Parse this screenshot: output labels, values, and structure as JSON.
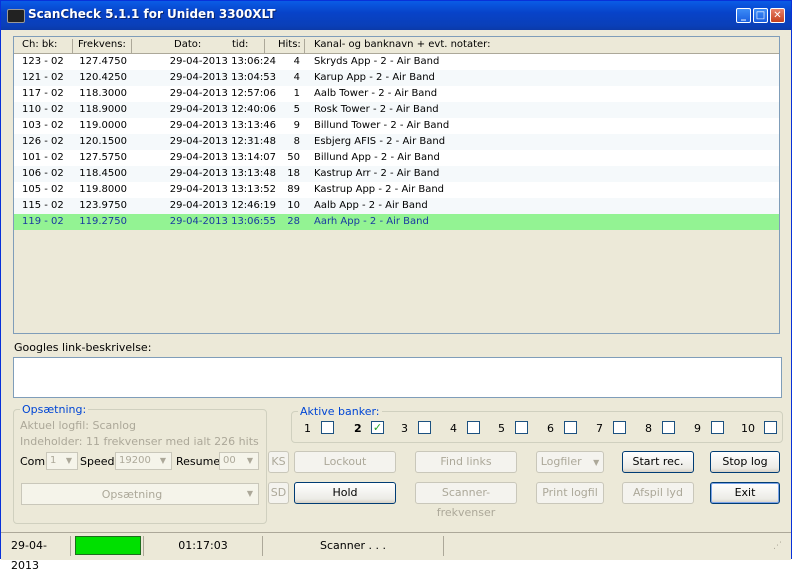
{
  "window": {
    "title": "ScanCheck 5.1.1 for Uniden 3300XLT",
    "controls": {
      "minimize": "_",
      "maximize": "□",
      "close": "✕"
    }
  },
  "list": {
    "headers": {
      "ch": "Ch:  bk:",
      "freq": "Frekvens:",
      "date": "Dato:",
      "time": "tid:",
      "hits": "Hits:",
      "name": "Kanal- og banknavn + evt. notater:"
    },
    "rows": [
      {
        "ch": "123 - 02",
        "freq": "127.4750",
        "dt": "29-04-2013 13:06:24",
        "hits": "4",
        "name": "Skryds App  -  2 - Air Band"
      },
      {
        "ch": "121 - 02",
        "freq": "120.4250",
        "dt": "29-04-2013 13:04:53",
        "hits": "4",
        "name": "Karup App  -  2 - Air Band"
      },
      {
        "ch": "117 - 02",
        "freq": "118.3000",
        "dt": "29-04-2013 12:57:06",
        "hits": "1",
        "name": "Aalb Tower  -  2 - Air Band"
      },
      {
        "ch": "110 - 02",
        "freq": "118.9000",
        "dt": "29-04-2013 12:40:06",
        "hits": "5",
        "name": "Rosk Tower  -  2 - Air Band"
      },
      {
        "ch": "103 - 02",
        "freq": "119.0000",
        "dt": "29-04-2013 13:13:46",
        "hits": "9",
        "name": "Billund Tower  -  2 - Air Band"
      },
      {
        "ch": "126 - 02",
        "freq": "120.1500",
        "dt": "29-04-2013 12:31:48",
        "hits": "8",
        "name": "Esbjerg AFIS  -  2 - Air Band"
      },
      {
        "ch": "101 - 02",
        "freq": "127.5750",
        "dt": "29-04-2013 13:14:07",
        "hits": "50",
        "name": "Billund App  -  2 - Air Band"
      },
      {
        "ch": "106 - 02",
        "freq": "118.4500",
        "dt": "29-04-2013 13:13:48",
        "hits": "18",
        "name": "Kastrup Arr  -  2 - Air Band"
      },
      {
        "ch": "105 - 02",
        "freq": "119.8000",
        "dt": "29-04-2013 13:13:52",
        "hits": "89",
        "name": "Kastrup App  -  2 - Air Band"
      },
      {
        "ch": "115 - 02",
        "freq": "123.9750",
        "dt": "29-04-2013 12:46:19",
        "hits": "10",
        "name": "Aalb App  -  2 - Air Band"
      },
      {
        "ch": "119 - 02",
        "freq": "119.2750",
        "dt": "29-04-2013 13:06:55",
        "hits": "28",
        "name": "Aarh App  -  2 - Air Band"
      }
    ],
    "selected_row_color": "#93f393"
  },
  "google": {
    "label": "Googles link-beskrivelse:",
    "text": ""
  },
  "setup": {
    "legend": "Opsætning:",
    "logfile_line": "Aktuel logfil: Scanlog",
    "contents_line": "Indeholder:  11 frekvenser med ialt 226 hits",
    "com_label": "Com:",
    "com_value": "1",
    "speed_label": "Speed:",
    "speed_value": "19200",
    "resume_label": "Resume",
    "resume_value": "00",
    "setup_combo": "Opsætning"
  },
  "banks": {
    "legend": "Aktive banker:",
    "items": [
      {
        "num": "1",
        "checked": false
      },
      {
        "num": "2",
        "checked": true
      },
      {
        "num": "3",
        "checked": false
      },
      {
        "num": "4",
        "checked": false
      },
      {
        "num": "5",
        "checked": false
      },
      {
        "num": "6",
        "checked": false
      },
      {
        "num": "7",
        "checked": false
      },
      {
        "num": "8",
        "checked": false
      },
      {
        "num": "9",
        "checked": false
      },
      {
        "num": "10",
        "checked": false
      }
    ]
  },
  "buttons": {
    "ks": "KS",
    "sd": "SD",
    "lockout": "Lockout",
    "hold": "Hold",
    "find_links": "Find links",
    "scanner_freq": "Scanner-frekvenser",
    "logfiler": "Logfiler",
    "print_log": "Print logfil",
    "start_rec": "Start rec.",
    "play_sound": "Afspil lyd",
    "stop_log": "Stop log",
    "exit": "Exit"
  },
  "status": {
    "date": "29-04-2013",
    "indicator_color": "#00e000",
    "time": "01:17:03",
    "state": "Scanner . . ."
  }
}
